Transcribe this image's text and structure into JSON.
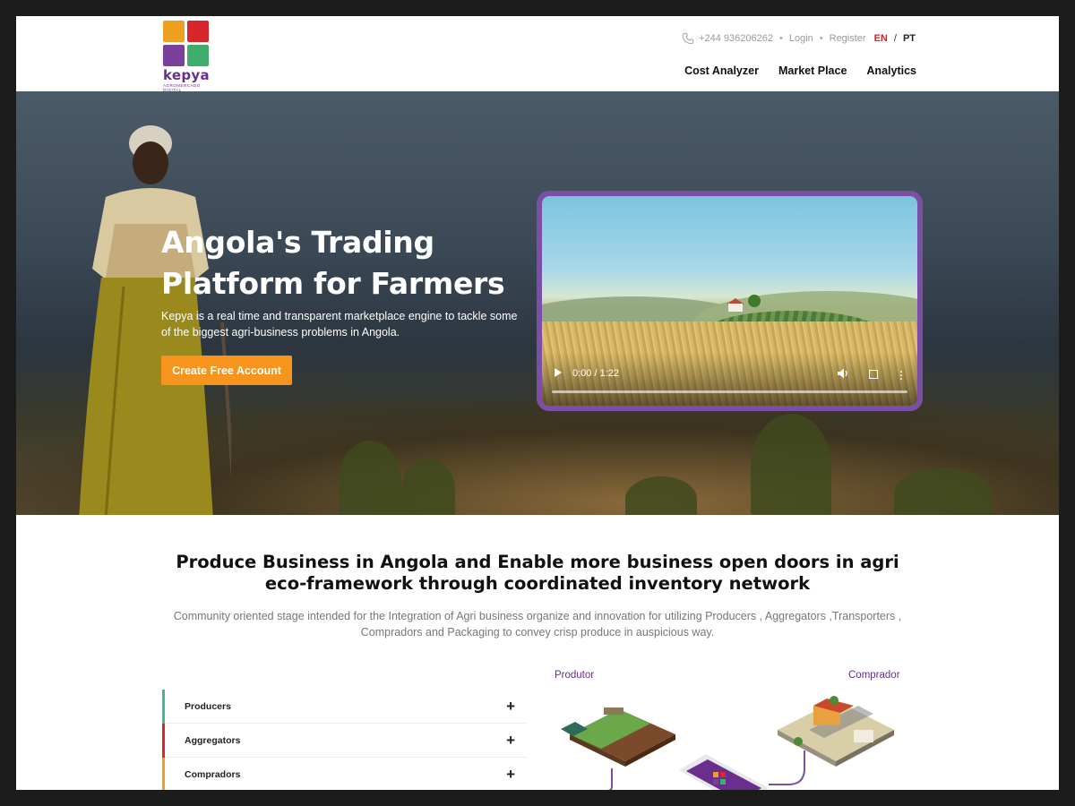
{
  "brand": {
    "name": "kepya",
    "tagline": "AGROMERCADO DIGITAL",
    "logo_colors": [
      "#f0a020",
      "#d9262c",
      "#7b3f9c",
      "#3fae6a"
    ]
  },
  "topbar": {
    "phone": "+244 936206262",
    "login": "Login",
    "register": "Register",
    "lang_en": "EN",
    "lang_sep": "/",
    "lang_pt": "PT"
  },
  "nav": {
    "items": [
      {
        "label": "Cost Analyzer"
      },
      {
        "label": "Market Place"
      },
      {
        "label": "Analytics"
      }
    ]
  },
  "hero": {
    "title": "Angola's Trading Platform for Farmers",
    "subtitle": "Kepya is a real time and transparent marketplace engine to tackle some of the biggest agri-business problems in Angola.",
    "cta": "Create Free Account"
  },
  "video": {
    "time": "0:00 / 1:22",
    "progress": 0,
    "border_color": "#7b4fa6"
  },
  "section": {
    "title": "Produce Business in Angola and Enable more business open doors in agri eco-framework through coordinated inventory network",
    "description": "Community oriented stage intended for the Integration of Agri business organize and innovation for utilizing Producers , Aggregators ,Transporters , Compradors and Packaging to convey crisp produce in auspicious way."
  },
  "accordion": {
    "items": [
      {
        "label": "Producers",
        "color": "#3fb8a0"
      },
      {
        "label": "Aggregators",
        "color": "#d9262c"
      },
      {
        "label": "Compradors",
        "color": "#f0a020"
      }
    ],
    "expand_symbol": "+"
  },
  "illustration": {
    "left_label": "Produtor",
    "right_label": "Comprador"
  },
  "colors": {
    "accent_orange": "#f7941d",
    "purple": "#6a2e8c",
    "lang_active": "#e02020"
  }
}
